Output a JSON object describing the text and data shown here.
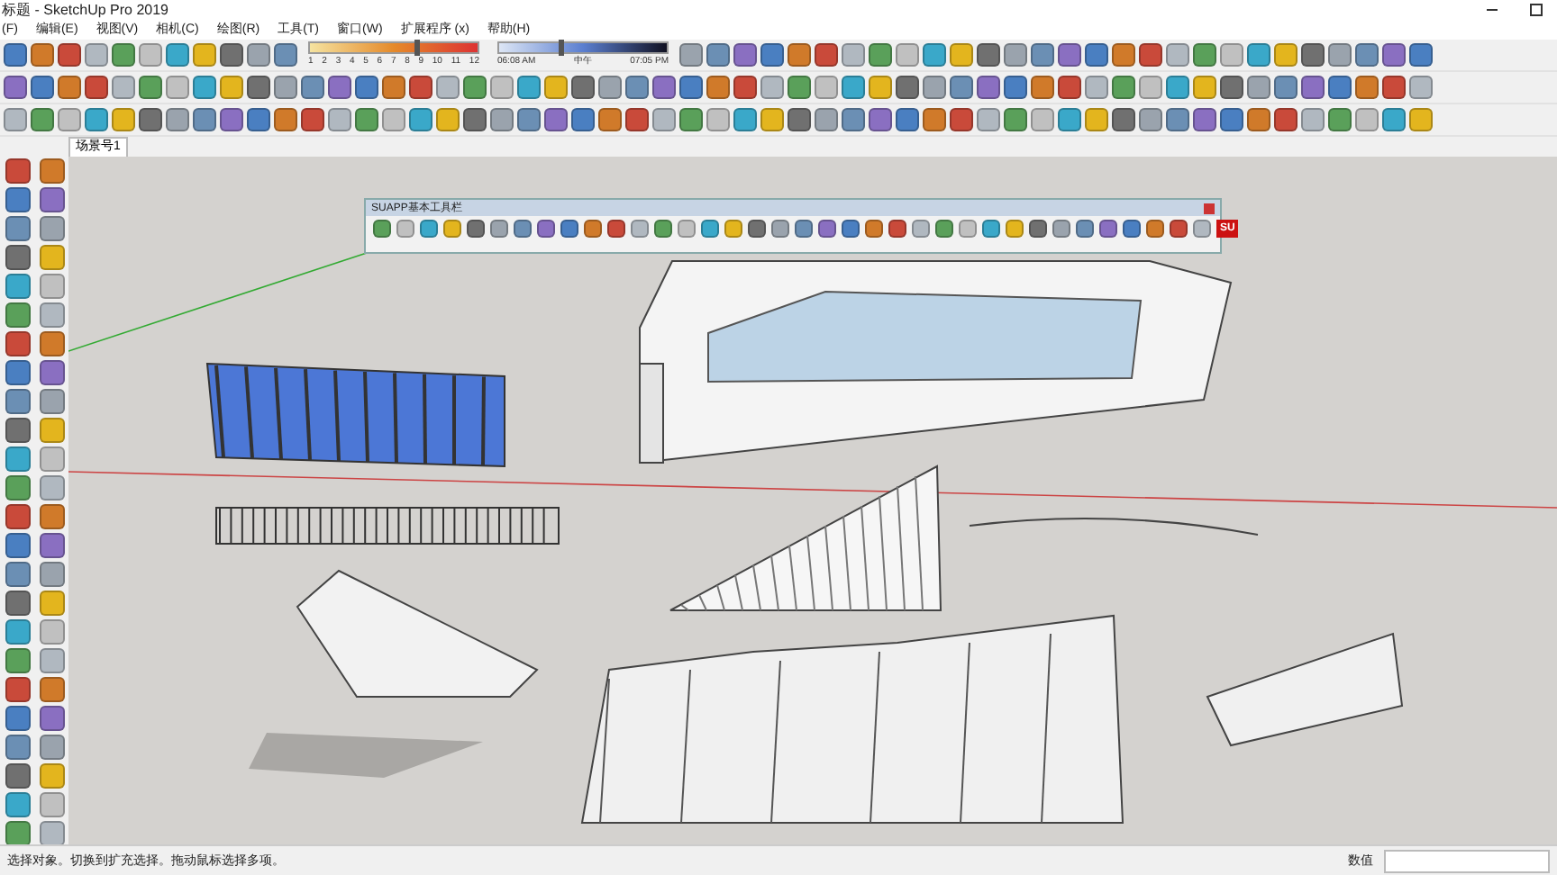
{
  "window": {
    "title": "标题 - SketchUp Pro 2019"
  },
  "menu": [
    "(F)",
    "编辑(E)",
    "视图(V)",
    "相机(C)",
    "绘图(R)",
    "工具(T)",
    "窗口(W)",
    "扩展程序 (x)",
    "帮助(H)"
  ],
  "shadow_slider": {
    "months": [
      "1",
      "2",
      "3",
      "4",
      "5",
      "6",
      "7",
      "8",
      "9",
      "10",
      "11",
      "12"
    ],
    "month_slider": {
      "level": 0.62
    },
    "time_start": "06:08 AM",
    "time_mid": "中午",
    "time_end": "07:05 PM",
    "time_slider": {
      "level": 0.35
    }
  },
  "scene_tabs": [
    {
      "label": "场景号1",
      "selected": true
    }
  ],
  "floating_toolbar": {
    "title": "SUAPP基本工具栏",
    "badge": "SU"
  },
  "status_bar": {
    "message": "选择对象。切换到扩充选择。拖动鼠标选择多项。",
    "value_label": "数值"
  }
}
